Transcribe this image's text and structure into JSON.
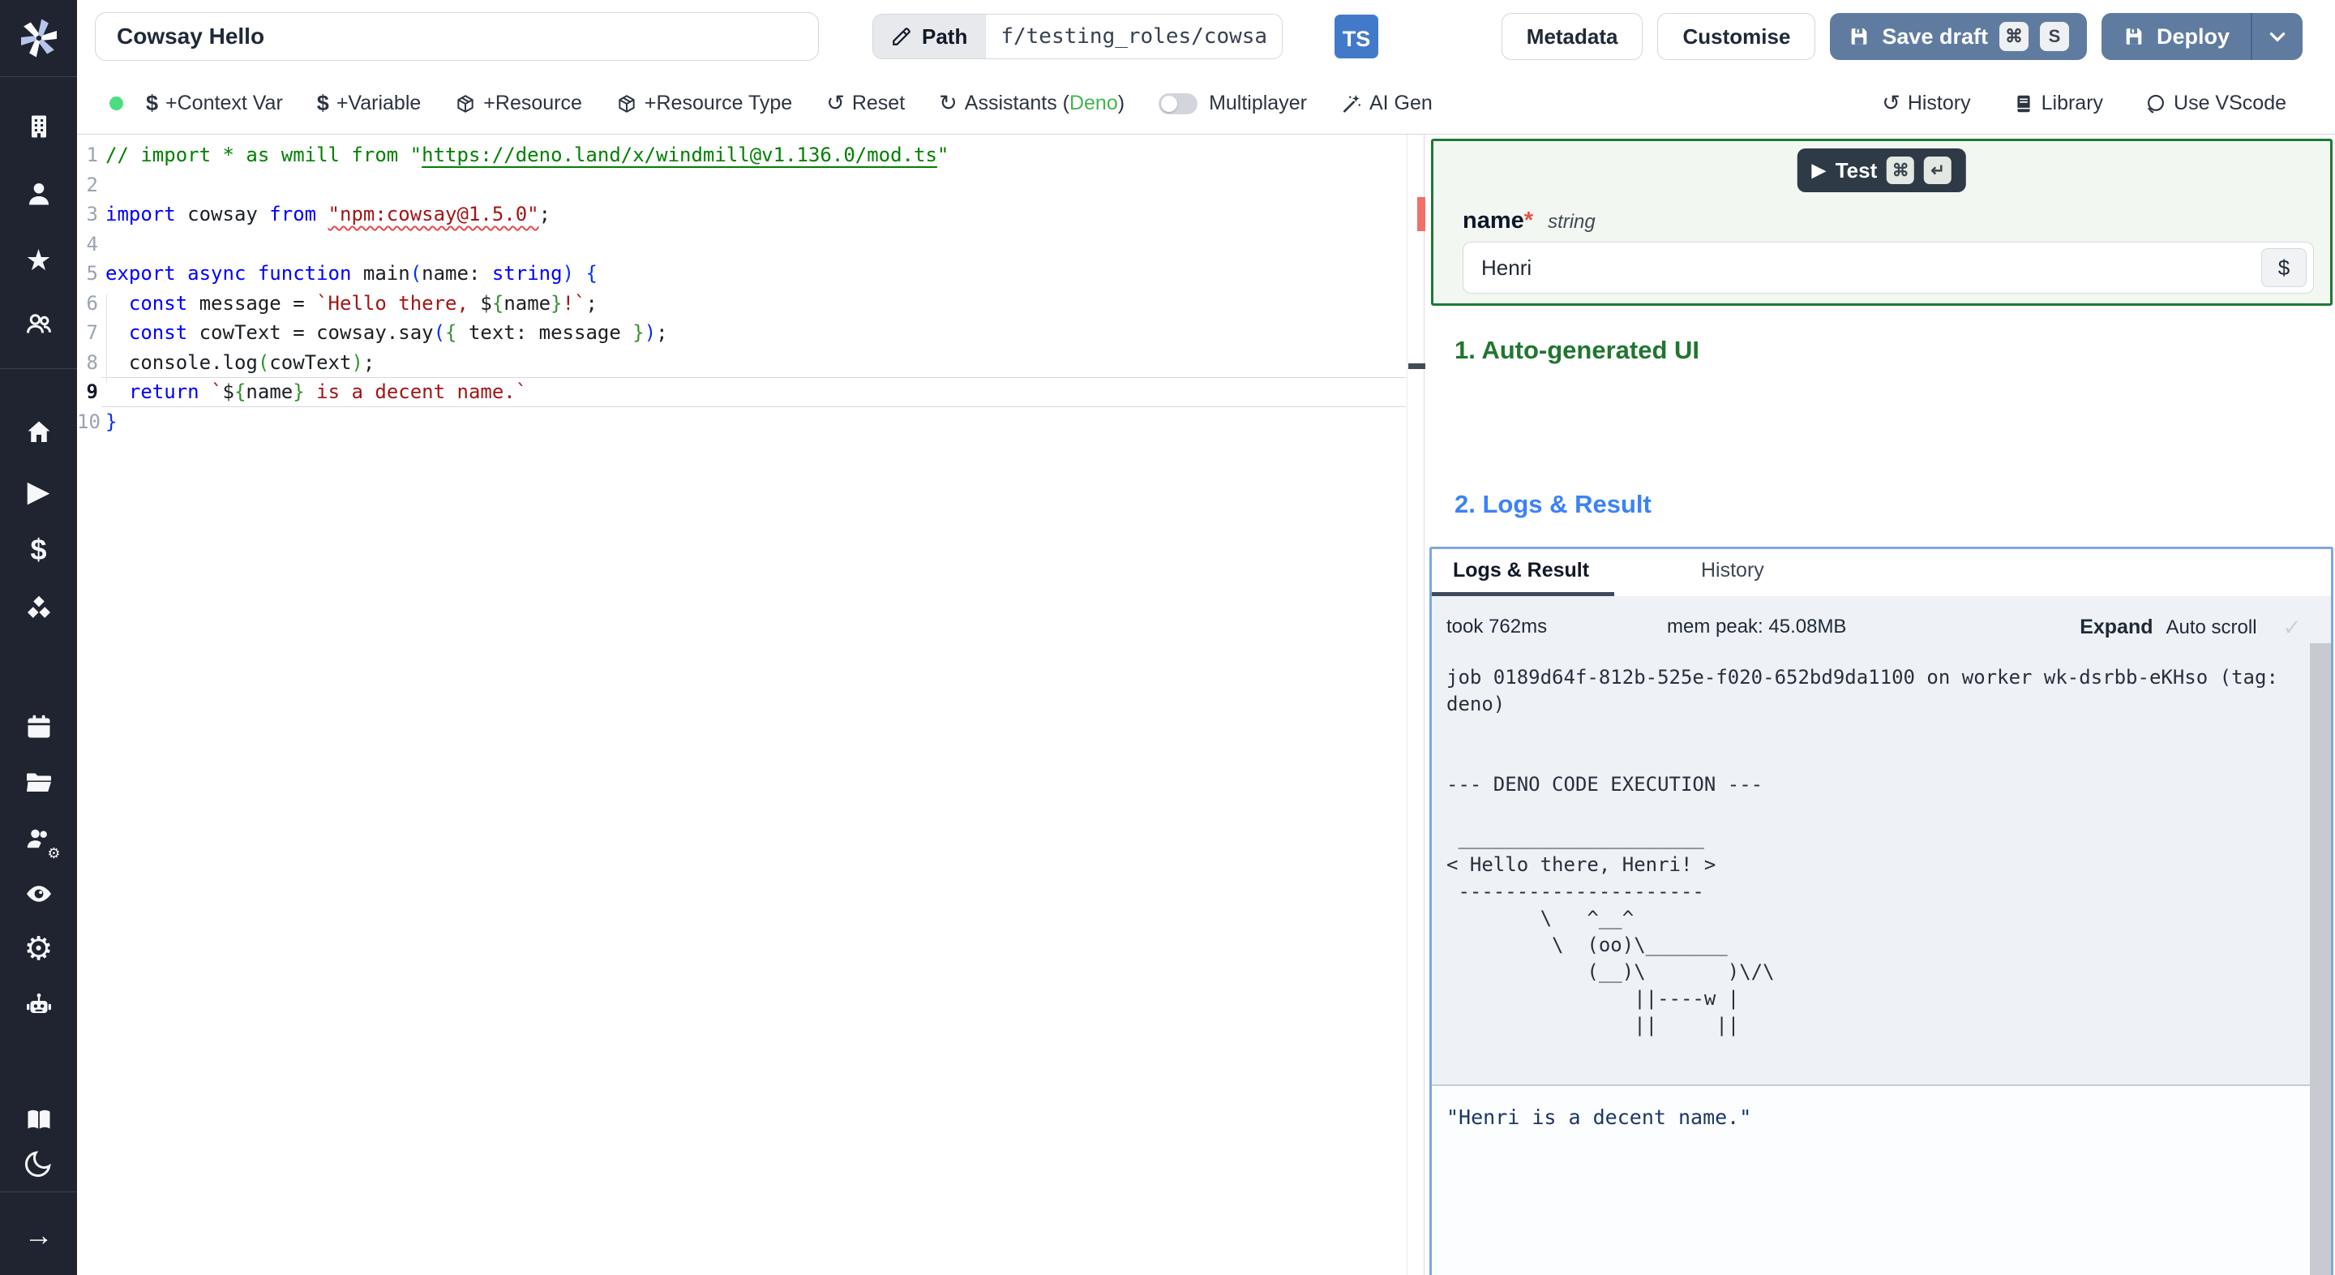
{
  "topbar": {
    "title_value": "Cowsay Hello",
    "path_label": "Path",
    "path_value": "f/testing_roles/cowsa",
    "lang_badge": "TS",
    "metadata_label": "Metadata",
    "customise_label": "Customise",
    "save_draft_label": "Save draft",
    "save_kbd_letter": "S",
    "deploy_label": "Deploy"
  },
  "toolbar": {
    "context_var": "+Context Var",
    "variable": "+Variable",
    "resource": "+Resource",
    "resource_type": "+Resource Type",
    "reset": "Reset",
    "assistants_prefix": "Assistants (",
    "assistants_lang": "Deno",
    "assistants_suffix": ")",
    "multiplayer": "Multiplayer",
    "ai_gen": "AI Gen",
    "history": "History",
    "library": "Library",
    "use_vscode": "Use VScode"
  },
  "icons": {
    "cmd": "⌘",
    "enter": "↵",
    "check": "✓",
    "dollar": "$",
    "reset": "↺",
    "assistants": "↻",
    "history": "↺",
    "star": "★",
    "gear": "⚙",
    "play": "▶",
    "arrow_right": "→",
    "status_dot_color": "#4ade80",
    "deno_green": "#44b54e"
  },
  "editor": {
    "lines": [
      {
        "n": "1",
        "tokens": [
          {
            "t": "// import * as wmill from \"",
            "c": "cm"
          },
          {
            "t": "https://deno.land/x/windmill@v1.136.0/mod.ts",
            "c": "cm lnk"
          },
          {
            "t": "\"",
            "c": "cm"
          }
        ]
      },
      {
        "n": "2",
        "tokens": []
      },
      {
        "n": "3",
        "tokens": [
          {
            "t": "import",
            "c": "kw"
          },
          {
            "t": " cowsay ",
            "c": "pl"
          },
          {
            "t": "from",
            "c": "kw"
          },
          {
            "t": " ",
            "c": "pl"
          },
          {
            "t": "\"npm:cowsay@1.5.0\"",
            "c": "str sq"
          },
          {
            "t": ";",
            "c": "pl"
          }
        ]
      },
      {
        "n": "4",
        "tokens": []
      },
      {
        "n": "5",
        "tokens": [
          {
            "t": "export",
            "c": "kw"
          },
          {
            "t": " ",
            "c": "pl"
          },
          {
            "t": "async",
            "c": "kw"
          },
          {
            "t": " ",
            "c": "pl"
          },
          {
            "t": "function",
            "c": "kw"
          },
          {
            "t": " main",
            "c": "pl"
          },
          {
            "t": "(",
            "c": "b1"
          },
          {
            "t": "name",
            "c": "pl"
          },
          {
            "t": ": ",
            "c": "pl"
          },
          {
            "t": "string",
            "c": "kw"
          },
          {
            "t": ")",
            "c": "b1"
          },
          {
            "t": " {",
            "c": "b1"
          }
        ]
      },
      {
        "n": "6",
        "tokens": [
          {
            "t": "  ",
            "c": "pl"
          },
          {
            "t": "const",
            "c": "kw"
          },
          {
            "t": " message = ",
            "c": "pl"
          },
          {
            "t": "`Hello there, ",
            "c": "str"
          },
          {
            "t": "$",
            "c": "pl"
          },
          {
            "t": "{",
            "c": "b2"
          },
          {
            "t": "name",
            "c": "pl"
          },
          {
            "t": "}",
            "c": "b2"
          },
          {
            "t": "!`",
            "c": "str"
          },
          {
            "t": ";",
            "c": "pl"
          }
        ]
      },
      {
        "n": "7",
        "tokens": [
          {
            "t": "  ",
            "c": "pl"
          },
          {
            "t": "const",
            "c": "kw"
          },
          {
            "t": " cowText = cowsay.say",
            "c": "pl"
          },
          {
            "t": "(",
            "c": "b1"
          },
          {
            "t": "{",
            "c": "b2"
          },
          {
            "t": " text: message ",
            "c": "pl"
          },
          {
            "t": "}",
            "c": "b2"
          },
          {
            "t": ")",
            "c": "b1"
          },
          {
            "t": ";",
            "c": "pl"
          }
        ]
      },
      {
        "n": "8",
        "tokens": [
          {
            "t": "  console.log",
            "c": "pl"
          },
          {
            "t": "(",
            "c": "b2"
          },
          {
            "t": "cowText",
            "c": "pl"
          },
          {
            "t": ")",
            "c": "b2"
          },
          {
            "t": ";",
            "c": "pl"
          }
        ]
      },
      {
        "n": "9",
        "active": true,
        "tokens": [
          {
            "t": "  ",
            "c": "pl"
          },
          {
            "t": "return",
            "c": "kw"
          },
          {
            "t": " ",
            "c": "pl"
          },
          {
            "t": "`",
            "c": "str"
          },
          {
            "t": "$",
            "c": "pl"
          },
          {
            "t": "{",
            "c": "b2"
          },
          {
            "t": "name",
            "c": "pl"
          },
          {
            "t": "}",
            "c": "b2"
          },
          {
            "t": " is a decent name.`",
            "c": "str"
          }
        ]
      },
      {
        "n": "10",
        "tokens": [
          {
            "t": "}",
            "c": "b1"
          }
        ]
      }
    ]
  },
  "test_panel": {
    "test_label": "Test",
    "field_name": "name",
    "required_mark": "*",
    "field_type": "string",
    "field_value": "Henri",
    "dollar_button": "$"
  },
  "sections": {
    "auto_ui": "1. Auto-generated UI",
    "logs_result": "2. Logs & Result"
  },
  "logs": {
    "tab_logs": "Logs & Result",
    "tab_history": "History",
    "took": "took 762ms",
    "mem": "mem peak: 45.08MB",
    "expand": "Expand",
    "autoscroll": "Auto scroll",
    "log_text": "job 0189d64f-812b-525e-f020-652bd9da1100 on worker wk-dsrbb-eKHso (tag:\ndeno)\n\n\n--- DENO CODE EXECUTION ---\n\n _____________________\n< Hello there, Henri! >\n ---------------------\n        \\   ^__^\n         \\  (oo)\\_______\n            (__)\\       )\\/\\\n                ||----w |\n                ||     ||",
    "result": "\"Henri is a decent name.\""
  },
  "sidebar": {
    "icon_names": [
      "windmill-logo",
      "building",
      "user",
      "star",
      "users",
      "home",
      "play",
      "dollar",
      "cubes",
      "calendar",
      "folder",
      "users-gear",
      "eye",
      "gear",
      "robot",
      "book",
      "moon",
      "arrow-right"
    ]
  }
}
